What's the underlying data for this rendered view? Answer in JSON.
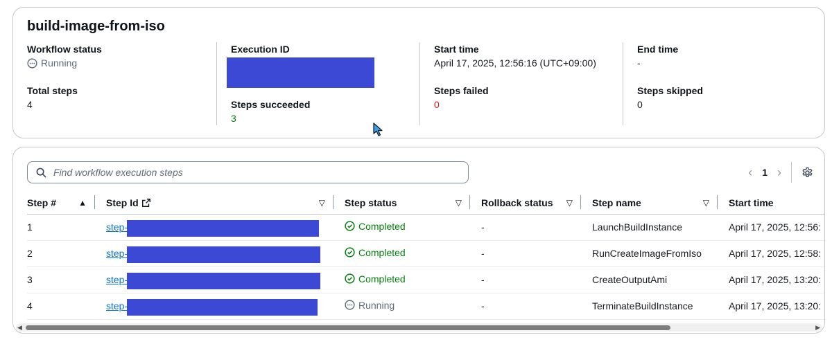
{
  "summary": {
    "title": "build-image-from-iso",
    "workflow_status_label": "Workflow status",
    "workflow_status_value": "Running",
    "total_steps_label": "Total steps",
    "total_steps_value": "4",
    "execution_id_label": "Execution ID",
    "steps_succeeded_label": "Steps succeeded",
    "steps_succeeded_value": "3",
    "start_time_label": "Start time",
    "start_time_value": "April 17, 2025, 12:56:16 (UTC+09:00)",
    "steps_failed_label": "Steps failed",
    "steps_failed_value": "0",
    "end_time_label": "End time",
    "end_time_value": "-",
    "steps_skipped_label": "Steps skipped",
    "steps_skipped_value": "0"
  },
  "search": {
    "placeholder": "Find workflow execution steps"
  },
  "pagination": {
    "current_page": "1"
  },
  "table": {
    "columns": [
      "Step #",
      "Step Id",
      "Step status",
      "Rollback status",
      "Step name",
      "Start time"
    ],
    "rows": [
      {
        "num": "1",
        "id_prefix": "step-",
        "status": "Completed",
        "rollback": "-",
        "name": "LaunchBuildInstance",
        "start": "April 17, 2025, 12:56:"
      },
      {
        "num": "2",
        "id_prefix": "step-",
        "status": "Completed",
        "rollback": "-",
        "name": "RunCreateImageFromIso",
        "start": "April 17, 2025, 12:58:"
      },
      {
        "num": "3",
        "id_prefix": "step-",
        "status": "Completed",
        "rollback": "-",
        "name": "CreateOutputAmi",
        "start": "April 17, 2025, 13:20:"
      },
      {
        "num": "4",
        "id_prefix": "step-",
        "status": "Running",
        "rollback": "-",
        "name": "TerminateBuildInstance",
        "start": "April 17, 2025, 13:20:"
      }
    ]
  },
  "colors": {
    "success": "#037f0c",
    "error": "#d91515",
    "link": "#0972d3",
    "redaction": "#3c49d4"
  },
  "icons": {
    "status_running": "pending-circle-icon",
    "status_completed": "check-circle-icon",
    "search": "search-icon",
    "external": "external-link-icon",
    "settings": "gear-icon"
  }
}
